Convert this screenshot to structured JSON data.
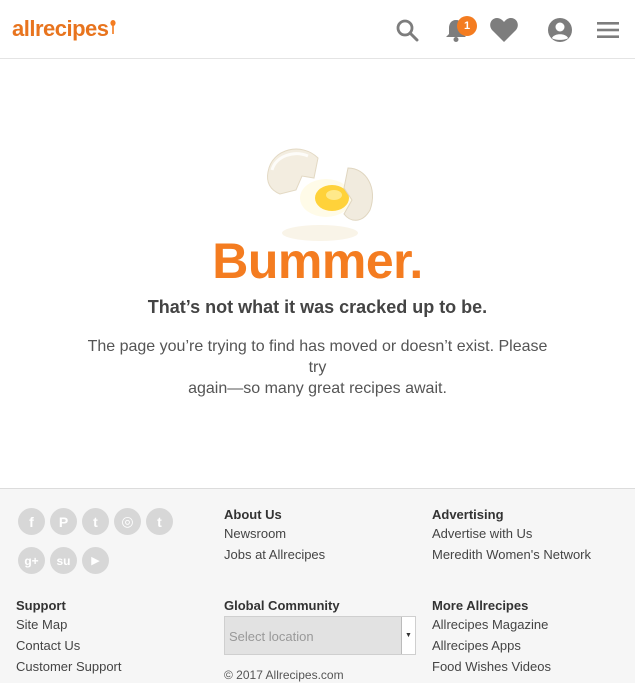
{
  "header": {
    "logo_text": "allrecipes",
    "notification_count": "1",
    "accent": "#f47c20"
  },
  "hero": {
    "headline": "Bummer.",
    "subhead": "That’s not what it was cracked up to be.",
    "message_line1": "The page you’re trying to find has moved or doesn’t exist. Please try",
    "message_line2": "again—so many great recipes await."
  },
  "footer": {
    "socials": [
      {
        "name": "facebook",
        "glyph": "f"
      },
      {
        "name": "pinterest",
        "glyph": "P"
      },
      {
        "name": "twitter",
        "glyph": "t"
      },
      {
        "name": "instagram",
        "glyph": "◎"
      },
      {
        "name": "tumblr",
        "glyph": "t"
      },
      {
        "name": "google-plus",
        "glyph": "g+"
      },
      {
        "name": "stumbleupon",
        "glyph": "su"
      },
      {
        "name": "youtube",
        "glyph": "▶"
      }
    ],
    "about": {
      "title": "About Us",
      "links": [
        "Newsroom",
        "Jobs at Allrecipes"
      ]
    },
    "advertising": {
      "title": "Advertising",
      "links": [
        "Advertise with Us",
        "Meredith Women's Network"
      ]
    },
    "support": {
      "title": "Support",
      "links": [
        "Site Map",
        "Contact Us",
        "Customer Support"
      ]
    },
    "global": {
      "title": "Global Community",
      "select_placeholder": "Select location"
    },
    "more": {
      "title": "More Allrecipes",
      "links": [
        "Allrecipes Magazine",
        "Allrecipes Apps",
        "Food Wishes Videos"
      ]
    },
    "copyright": "© 2017 Allrecipes.com"
  }
}
